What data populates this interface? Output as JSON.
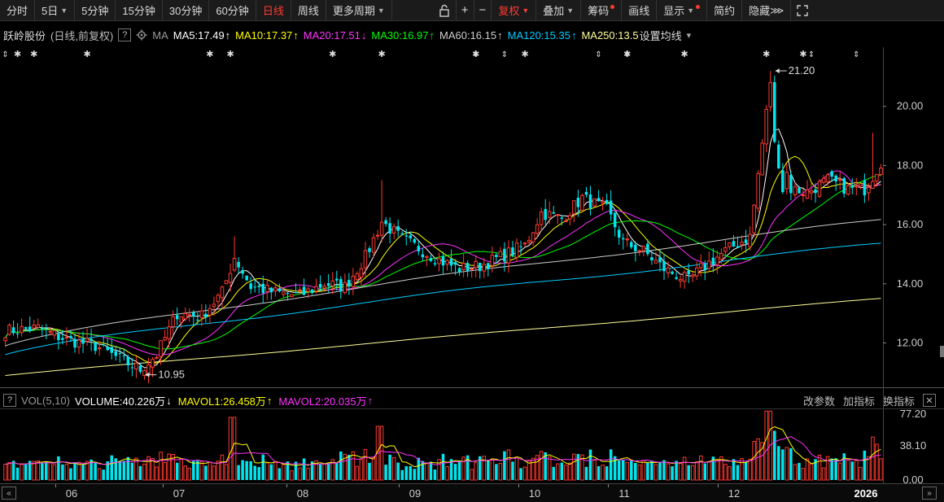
{
  "toolbar": {
    "left_items": [
      {
        "label": "分时",
        "caret": false,
        "active": false
      },
      {
        "label": "5日",
        "caret": true,
        "active": false
      },
      {
        "label": "5分钟",
        "caret": false,
        "active": false
      },
      {
        "label": "15分钟",
        "caret": false,
        "active": false
      },
      {
        "label": "30分钟",
        "caret": false,
        "active": false
      },
      {
        "label": "60分钟",
        "caret": false,
        "active": false
      },
      {
        "label": "日线",
        "caret": false,
        "active": true
      },
      {
        "label": "周线",
        "caret": false,
        "active": false
      },
      {
        "label": "更多周期",
        "caret": true,
        "active": false
      }
    ],
    "lock_icon": "lock-icon",
    "plus": "+",
    "minus": "−",
    "fuquan": "复权",
    "diejia": "叠加",
    "chouma": "筹码",
    "huaxian": "画线",
    "xianshi": "显示",
    "jianyue": "简约",
    "yincang": "隐藏",
    "fullscreen_icon": "fullscreen-icon"
  },
  "ma_legend": {
    "stock": "跃岭股份",
    "mode": "(日线,前复权)",
    "help": "?",
    "gear_icon": "gear-icon",
    "ma": "MA",
    "items": [
      {
        "text": "MA5:17.49",
        "arrow": "↑",
        "color": "#ffffff"
      },
      {
        "text": "MA10:17.37",
        "arrow": "↑",
        "color": "#ffff00"
      },
      {
        "text": "MA20:17.51",
        "arrow": "↓",
        "color": "#ff33ff"
      },
      {
        "text": "MA30:16.97",
        "arrow": "↑",
        "color": "#00ff00"
      },
      {
        "text": "MA60:16.15",
        "arrow": "↑",
        "color": "#cccccc"
      },
      {
        "text": "MA120:15.35",
        "arrow": "↑",
        "color": "#00ccff"
      },
      {
        "text": "MA250:13.5",
        "arrow": "",
        "color": "#ffff99"
      }
    ],
    "settings": "设置均线"
  },
  "vol_legend": {
    "box": "?",
    "name": "VOL(5,10)",
    "volume": "VOLUME:40.226万",
    "volume_arrow": "↓",
    "mavol1": "MAVOL1:26.458万",
    "mavol1_arrow": "↑",
    "mavol2": "MAVOL2:20.035万",
    "mavol2_arrow": "↑",
    "gaicanshu": "改参数",
    "jiazhibiao": "加指标",
    "huanzhibiao": "换指标",
    "close": "✕"
  },
  "colors": {
    "up": "#ff3b30",
    "down": "#00e5ee",
    "ma5": "#ffffff",
    "ma10": "#ffff00",
    "ma20": "#ff33ff",
    "ma30": "#00ff00",
    "ma60": "#cccccc",
    "ma120": "#00ccff",
    "ma250": "#ffff99"
  },
  "chart_data": {
    "type": "candlestick",
    "price_axis": {
      "ticks": [
        "20.00",
        "18.00",
        "16.00",
        "14.00",
        "12.00"
      ],
      "range": [
        10.5,
        22.0
      ]
    },
    "volume_axis": {
      "ticks": [
        "77.20",
        "38.10",
        "0.00"
      ],
      "range": [
        0,
        77.2
      ]
    },
    "x_labels": [
      "06",
      "07",
      "08",
      "09",
      "10",
      "11",
      "12",
      "2026"
    ],
    "annotations": [
      {
        "text": "21.20",
        "kind": "high"
      },
      {
        "text": "10.95",
        "kind": "low"
      }
    ],
    "series": [
      {
        "name": "MA5",
        "values": []
      },
      {
        "name": "MA10",
        "values": []
      },
      {
        "name": "MA20",
        "values": []
      },
      {
        "name": "MA30",
        "values": []
      },
      {
        "name": "MA60",
        "values": []
      },
      {
        "name": "MA120",
        "values": []
      },
      {
        "name": "MA250",
        "values": []
      }
    ],
    "keypoints": [
      [
        0,
        12.4
      ],
      [
        8,
        12.5
      ],
      [
        15,
        12.1
      ],
      [
        22,
        11.9
      ],
      [
        30,
        11.3
      ],
      [
        33,
        11.1
      ],
      [
        37,
        11.6
      ],
      [
        42,
        13.0
      ],
      [
        48,
        12.9
      ],
      [
        53,
        13.7
      ],
      [
        56,
        14.9
      ],
      [
        60,
        13.9
      ],
      [
        66,
        13.7
      ],
      [
        72,
        13.6
      ],
      [
        78,
        14.0
      ],
      [
        83,
        13.9
      ],
      [
        88,
        14.9
      ],
      [
        92,
        16.1
      ],
      [
        97,
        15.5
      ],
      [
        101,
        15.2
      ],
      [
        106,
        14.8
      ],
      [
        111,
        14.5
      ],
      [
        116,
        14.6
      ],
      [
        121,
        14.9
      ],
      [
        127,
        15.3
      ],
      [
        131,
        16.4
      ],
      [
        136,
        16.2
      ],
      [
        141,
        16.9
      ],
      [
        147,
        16.5
      ],
      [
        151,
        15.4
      ],
      [
        156,
        15.1
      ],
      [
        161,
        14.5
      ],
      [
        167,
        14.1
      ],
      [
        170,
        14.5
      ],
      [
        176,
        15.1
      ],
      [
        182,
        15.6
      ],
      [
        186,
        19.8
      ],
      [
        188,
        19.4
      ],
      [
        192,
        17.2
      ],
      [
        196,
        17.1
      ],
      [
        201,
        17.5
      ],
      [
        206,
        17.2
      ],
      [
        210,
        17.2
      ],
      [
        214,
        18.1
      ]
    ],
    "stars": [
      3,
      7,
      20,
      50,
      55,
      80,
      92,
      115,
      127,
      152,
      166,
      186,
      195
    ],
    "arrows": [
      0,
      115,
      122,
      145,
      152,
      197,
      208
    ]
  }
}
